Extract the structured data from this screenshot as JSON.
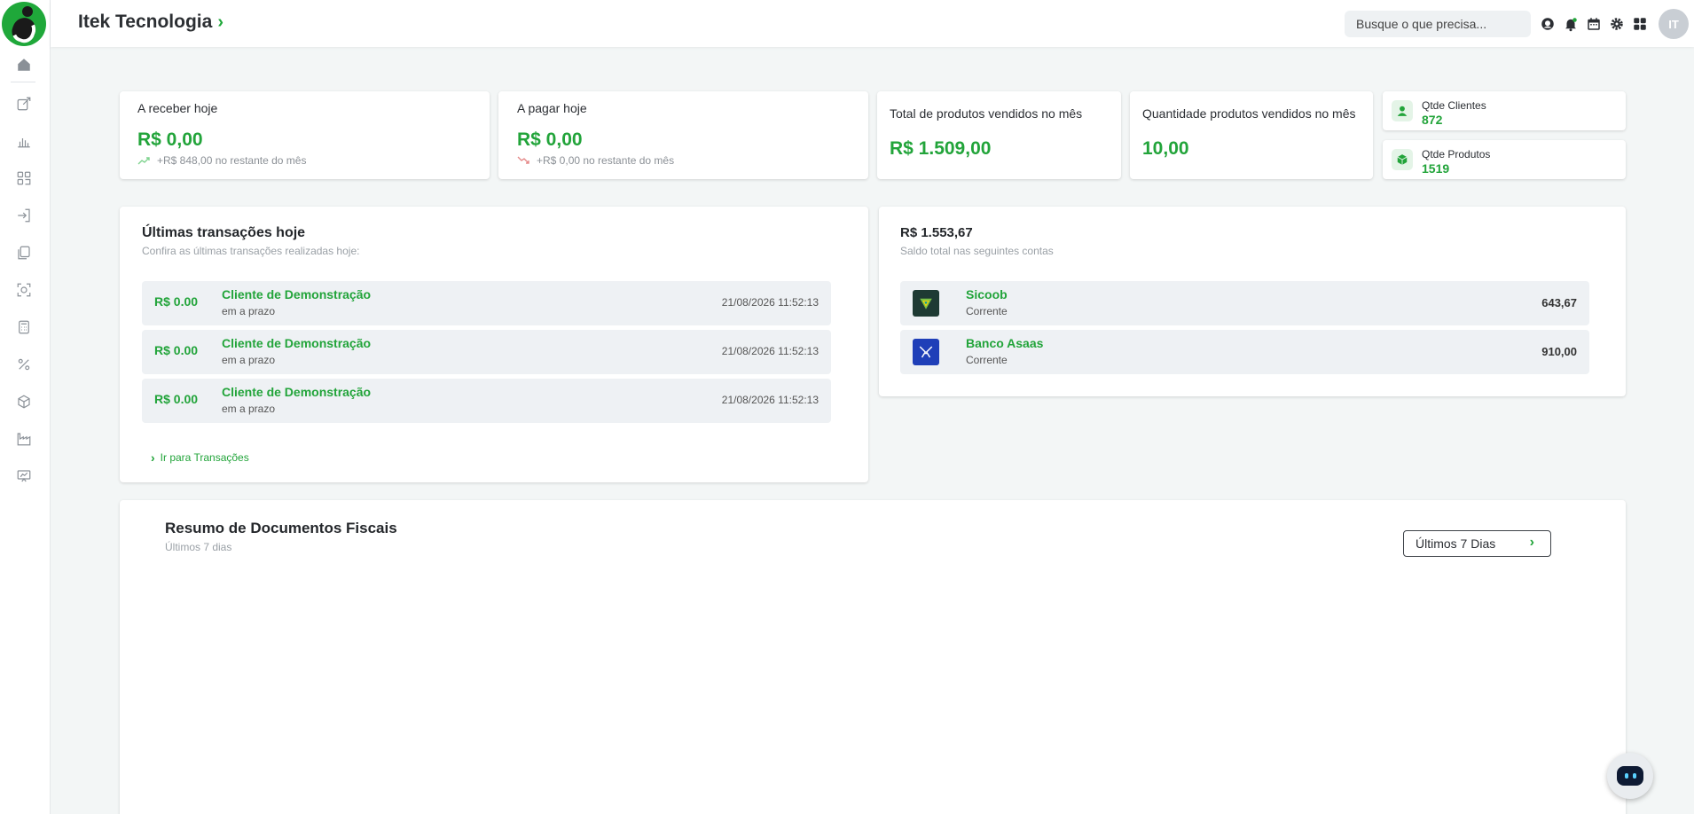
{
  "header": {
    "company_name": "Itek Tecnologia",
    "search_placeholder": "Busque o que precisa...",
    "avatar_initials": "IT",
    "icons": [
      "support-icon",
      "bell-icon",
      "calendar-icon",
      "gear-icon",
      "apps-icon"
    ]
  },
  "sidebar": {
    "icons": [
      "home-icon",
      "edit-icon",
      "bar-chart-icon",
      "scan-icon",
      "login-icon",
      "documents-icon",
      "camera-scan-icon",
      "calculator-icon",
      "percent-icon",
      "box-icon",
      "factory-icon",
      "presentation-icon"
    ]
  },
  "stats": {
    "receivable": {
      "label": "A receber hoje",
      "value": "R$ 0,00",
      "sub": "+R$ 848,00 no restante do mês"
    },
    "payable": {
      "label": "A pagar hoje",
      "value": "R$ 0,00",
      "sub": "+R$ 0,00 no restante do mês"
    },
    "products_total": {
      "label": "Total de produtos vendidos no mês",
      "value": "R$ 1.509,00"
    },
    "products_qty": {
      "label": "Quantidade produtos vendidos no mês",
      "value": "10,00"
    },
    "clients": {
      "label": "Qtde Clientes",
      "value": "872"
    },
    "products": {
      "label": "Qtde Produtos",
      "value": "1519"
    }
  },
  "transactions": {
    "title": "Últimas transações hoje",
    "subtitle": "Confira as últimas transações realizadas hoje:",
    "rows": [
      {
        "amount": "R$ 0.00",
        "client": "Cliente de Demonstração",
        "terms": "em a prazo",
        "date": "21/08/2026 11:52:13"
      },
      {
        "amount": "R$ 0.00",
        "client": "Cliente de Demonstração",
        "terms": "em a prazo",
        "date": "21/08/2026 11:52:13"
      },
      {
        "amount": "R$ 0.00",
        "client": "Cliente de Demonstração",
        "terms": "em a prazo",
        "date": "21/08/2026 11:52:13"
      }
    ],
    "link": "Ir para Transações"
  },
  "accounts": {
    "total": "R$ 1.553,67",
    "subtitle": "Saldo total nas seguintes contas",
    "rows": [
      {
        "name": "Sicoob",
        "type": "Corrente",
        "balance": "643,67",
        "color": "#1e3a33"
      },
      {
        "name": "Banco Asaas",
        "type": "Corrente",
        "balance": "910,00",
        "color": "#1f3fb8"
      }
    ]
  },
  "fiscal": {
    "title": "Resumo de Documentos Fiscais",
    "subtitle": "Últimos 7 dias",
    "period_button": "Últimos 7 Dias"
  },
  "colors": {
    "accent": "#22a43a",
    "trend_up": "#7fd38f",
    "trend_down": "#e58a8a"
  }
}
